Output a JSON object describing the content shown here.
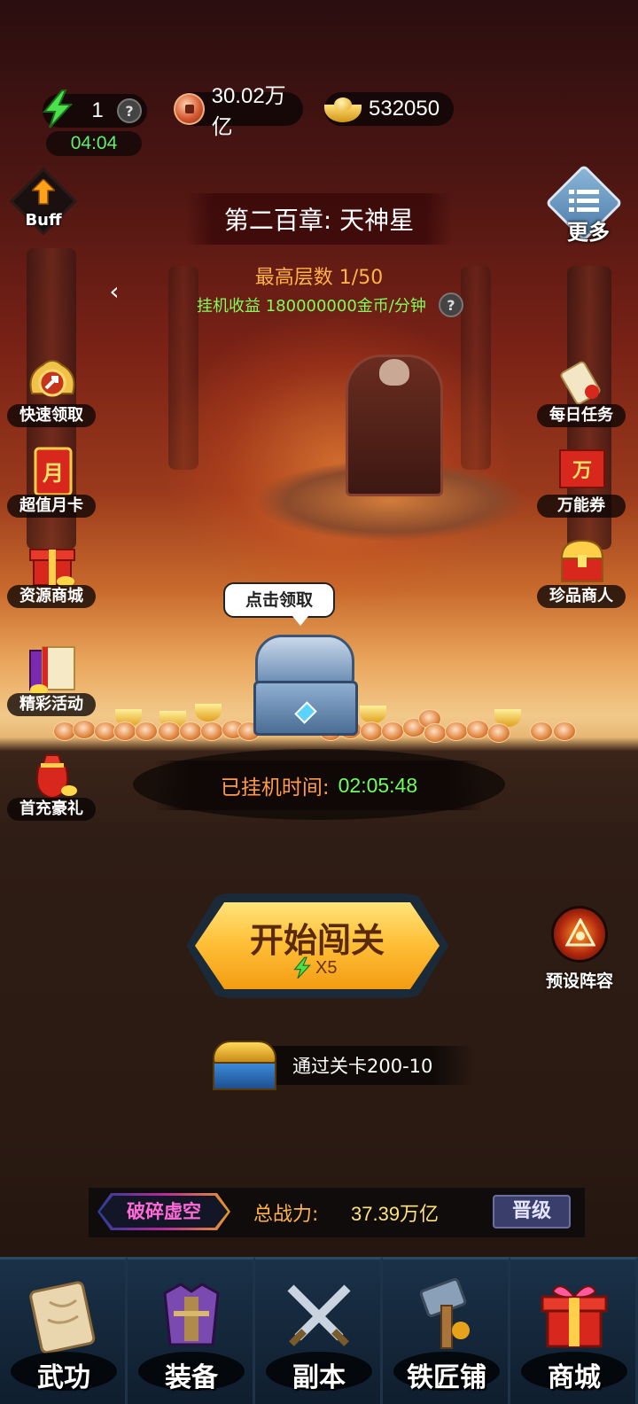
{
  "resources": {
    "energy": "1",
    "energy_timer": "04:04",
    "copper": "30.02万亿",
    "gold": "532050"
  },
  "buff_label": "Buff",
  "more_label": "更多",
  "chapter": {
    "title": "第二百章: 天神星",
    "floor": "最高层数 1/50",
    "income": "挂机收益 180000000金币/分钟"
  },
  "left_features": [
    {
      "label": "快速领取",
      "icon": "fast-claim-icon"
    },
    {
      "label": "超值月卡",
      "icon": "monthly-card-icon"
    },
    {
      "label": "资源商城",
      "icon": "resource-shop-icon"
    },
    {
      "label": "精彩活动",
      "icon": "events-icon"
    },
    {
      "label": "首充豪礼",
      "icon": "first-recharge-icon"
    }
  ],
  "right_features": [
    {
      "label": "每日任务",
      "icon": "daily-task-icon"
    },
    {
      "label": "万能券",
      "icon": "universal-coupon-icon"
    },
    {
      "label": "珍品商人",
      "icon": "treasure-merchant-icon"
    }
  ],
  "chest": {
    "bubble": "点击领取"
  },
  "idle": {
    "label": "已挂机时间:",
    "time": "02:05:48"
  },
  "start_button": {
    "label": "开始闯关",
    "cost": "X5"
  },
  "preset_label": "预设阵容",
  "pass_reward": "通过关卡200-10",
  "power": {
    "realm": "破碎虚空",
    "label": "总战力:",
    "value": "37.39万亿",
    "upgrade": "晋级"
  },
  "nav": [
    {
      "label": "武功",
      "icon": "martial-arts-scroll-icon"
    },
    {
      "label": "装备",
      "icon": "armor-icon"
    },
    {
      "label": "副本",
      "icon": "crossed-swords-icon"
    },
    {
      "label": "铁匠铺",
      "icon": "hammer-icon"
    },
    {
      "label": "商城",
      "icon": "gift-box-icon"
    }
  ],
  "colors": {
    "income_green": "#7dff5a",
    "floor_orange": "#ffb347",
    "timer_green": "#5ef16a",
    "button_gold": "#ffc13a"
  }
}
